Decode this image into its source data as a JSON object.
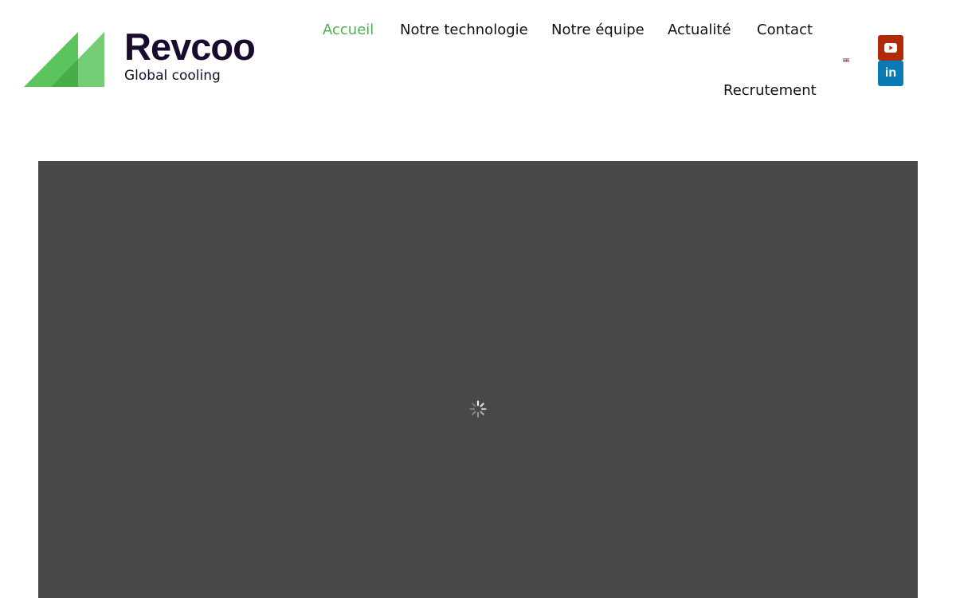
{
  "brand": {
    "name": "Revcoo",
    "tagline": "Global cooling",
    "colors": {
      "primary_green": "#4bb34b",
      "dark_text": "#1a0a2e"
    }
  },
  "nav": {
    "items": [
      {
        "label": "Accueil",
        "active": true
      },
      {
        "label": "Notre technologie",
        "active": false
      },
      {
        "label": "Notre équipe",
        "active": false
      },
      {
        "label": "Actualité",
        "active": false
      },
      {
        "label": "Contact",
        "active": false
      },
      {
        "label": "Recrutement",
        "active": false
      }
    ]
  },
  "language": {
    "icon": "uk-flag-icon"
  },
  "social": [
    {
      "icon": "youtube-icon",
      "color": "#b02a0a"
    },
    {
      "icon": "linkedin-icon",
      "color": "#0a7ab5",
      "glyph": "in"
    }
  ],
  "hero": {
    "background": "#484848",
    "state_icon": "loading-spinner-icon"
  }
}
